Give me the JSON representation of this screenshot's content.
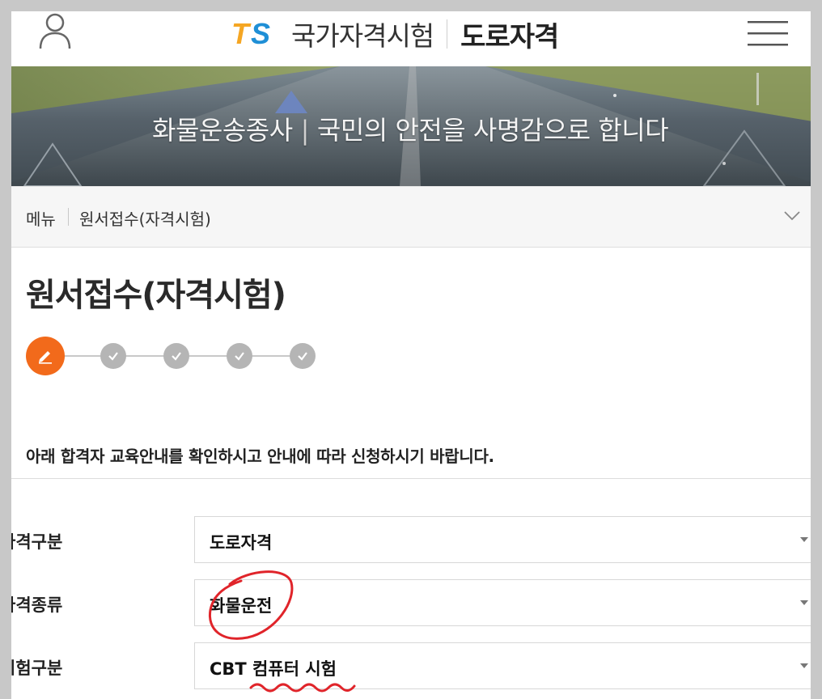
{
  "header": {
    "logo_mark": "TS",
    "logo_name": "국가자격시험",
    "logo_sub": "도로자격",
    "icons": {
      "user": "user-icon",
      "menu": "hamburger-menu-icon"
    }
  },
  "banner": {
    "lead": "화물운송종사",
    "separator": "|",
    "slogan": "국민의 안전을 사명감으로 합니다"
  },
  "breadcrumb": {
    "menu_label": "메뉴",
    "current_page": "원서접수(자격시험)",
    "icon": "chevron-down-icon"
  },
  "main": {
    "title": "원서접수(자격시험)",
    "steps": {
      "total": 5,
      "current": 1,
      "icons": [
        "pencil-icon",
        "check-icon",
        "check-icon",
        "check-icon",
        "check-icon"
      ]
    },
    "notice": "아래 합격자 교육안내를 확인하시고 안내에 따라 신청하시기 바랍니다."
  },
  "form": {
    "fields": [
      {
        "label": "자격구분",
        "value": "도로자격"
      },
      {
        "label": "자격종류",
        "value": "화물운전"
      },
      {
        "label": "시험구분",
        "value": "CBT 컴퓨터 시험"
      }
    ]
  },
  "colors": {
    "accent": "#f26a1b",
    "step_inactive": "#b5b5b5",
    "annotation": "#e0242a",
    "logo_t": "#f5a623",
    "logo_s": "#1f8fd6"
  }
}
